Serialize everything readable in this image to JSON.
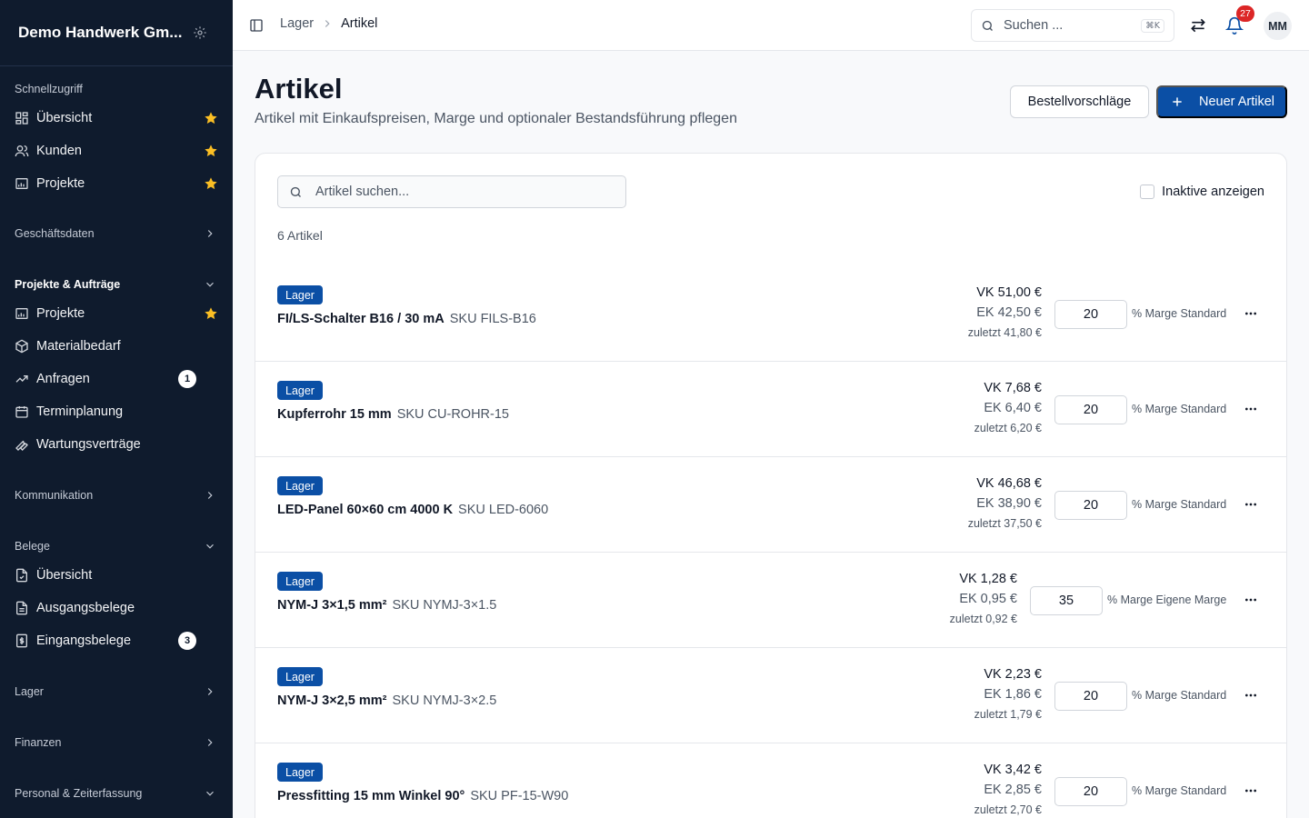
{
  "sidebar": {
    "company": "Demo Handwerk Gm...",
    "quick_label": "Schnellzugriff",
    "quick_items": [
      {
        "label": "Übersicht",
        "icon": "dashboard-icon"
      },
      {
        "label": "Kunden",
        "icon": "users-icon"
      },
      {
        "label": "Projekte",
        "icon": "project-icon"
      }
    ],
    "groups": {
      "business": "Geschäftsdaten",
      "projects": "Projekte & Aufträge",
      "communication": "Kommunikation",
      "documents": "Belege",
      "stock": "Lager",
      "finance": "Finanzen",
      "personnel": "Personal & Zeiterfassung"
    },
    "project_items": [
      {
        "label": "Projekte"
      },
      {
        "label": "Materialbedarf"
      },
      {
        "label": "Anfragen",
        "count": "1"
      },
      {
        "label": "Terminplanung"
      },
      {
        "label": "Wartungsverträge"
      }
    ],
    "document_items": [
      {
        "label": "Übersicht"
      },
      {
        "label": "Ausgangsbelege"
      },
      {
        "label": "Eingangsbelege",
        "count": "3"
      }
    ]
  },
  "topbar": {
    "breadcrumb": [
      "Lager",
      "Artikel"
    ],
    "search_label": "Suchen ...",
    "search_kbd": "⌘K",
    "notification_count": "27",
    "avatar": "MM"
  },
  "page": {
    "title": "Artikel",
    "subtitle": "Artikel mit Einkaufspreisen, Marge und optionaler Bestandsführung pflegen",
    "btn_suggestions": "Bestellvorschläge",
    "btn_new": "Neuer Artikel"
  },
  "list": {
    "search_placeholder": "Artikel suchen...",
    "inactive_label": "Inaktive anzeigen",
    "count_text": "6 Artikel",
    "items": [
      {
        "tag": "Lager",
        "name": "FI/LS-Schalter B16 / 30 mA",
        "sku": "SKU FILS-B16",
        "vk": "VK 51,00 €",
        "ek": "EK 42,50 €",
        "last": "zuletzt 41,80 €",
        "margin": "20",
        "margin_label": "% Marge Standard"
      },
      {
        "tag": "Lager",
        "name": "Kupferrohr 15 mm",
        "sku": "SKU CU-ROHR-15",
        "vk": "VK 7,68 €",
        "ek": "EK 6,40 €",
        "last": "zuletzt 6,20 €",
        "margin": "20",
        "margin_label": "% Marge Standard"
      },
      {
        "tag": "Lager",
        "name": "LED-Panel 60×60 cm 4000 K",
        "sku": "SKU LED-6060",
        "vk": "VK 46,68 €",
        "ek": "EK 38,90 €",
        "last": "zuletzt 37,50 €",
        "margin": "20",
        "margin_label": "% Marge Standard"
      },
      {
        "tag": "Lager",
        "name": "NYM-J 3×1,5 mm²",
        "sku": "SKU NYMJ-3×1.5",
        "vk": "VK 1,28 €",
        "ek": "EK 0,95 €",
        "last": "zuletzt 0,92 €",
        "margin": "35",
        "margin_label": "% Marge Eigene Marge"
      },
      {
        "tag": "Lager",
        "name": "NYM-J 3×2,5 mm²",
        "sku": "SKU NYMJ-3×2.5",
        "vk": "VK 2,23 €",
        "ek": "EK 1,86 €",
        "last": "zuletzt 1,79 €",
        "margin": "20",
        "margin_label": "% Marge Standard"
      },
      {
        "tag": "Lager",
        "name": "Pressfitting 15 mm Winkel 90°",
        "sku": "SKU PF-15-W90",
        "vk": "VK 3,42 €",
        "ek": "EK 2,85 €",
        "last": "zuletzt 2,70 €",
        "margin": "20",
        "margin_label": "% Marge Standard"
      }
    ]
  },
  "colors": {
    "sidebar_bg": "#0f1b2d",
    "primary": "#0b4fa5",
    "star": "#fbbf24",
    "badge_red": "#dc2626"
  }
}
